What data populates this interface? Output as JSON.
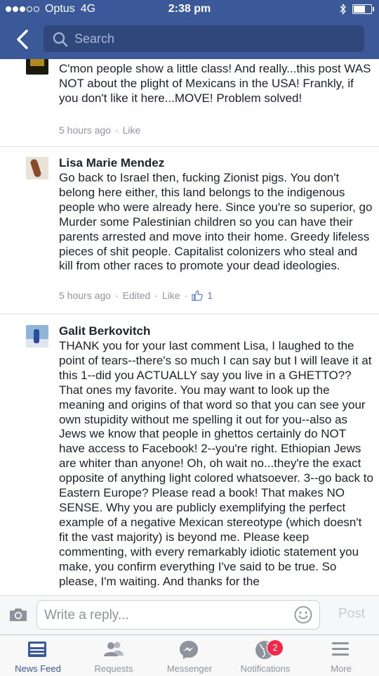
{
  "status_bar": {
    "carrier": "Optus",
    "network": "4G",
    "time": "2:38 pm"
  },
  "nav": {
    "search_placeholder": "Search"
  },
  "comments": [
    {
      "author": "",
      "text": "C'mon people show a little class! And really...this post WAS NOT about the plight of Mexicans in the USA! Frankly,  if you don't like it here...MOVE! Problem solved!",
      "time": "5 hours ago",
      "like_label": "Like"
    },
    {
      "author": "Lisa Marie Mendez",
      "text": "Go back to Israel then, fucking Zionist pigs. You don't belong here either, this land belongs to the indigenous people who were already here. Since you're so superior, go Murder some Palestinian children so you can have their parents arrested and move into their home. Greedy lifeless pieces of shit people. Capitalist colonizers who steal and kill from other races to promote your dead ideologies.",
      "time": "5 hours ago",
      "edited_label": "Edited",
      "like_label": "Like",
      "like_count": "1"
    },
    {
      "author": "Galit Berkovitch",
      "text": "THANK you for your last comment Lisa, I laughed to the point of tears--there's so much I can say but I will leave it at this 1--did you ACTUALLY say you live in a GHETTO?? That ones my favorite. You may want to look up the meaning and origins of that word so that you can see your own stupidity without me spelling it out for you--also as Jews we know that people in ghettos certainly do NOT have access to Facebook! 2--you're right. Ethiopian Jews are whiter than anyone! Oh, oh wait no...they're the exact opposite of anything light colored whatsoever. 3--go back to Eastern Europe? Please read a book! That makes NO SENSE. Why you are publicly exemplifying the perfect example of a negative Mexican stereotype (which doesn't fit the vast majority) is beyond me. Please keep commenting, with every remarkably idiotic statement you make, you confirm everything I've said to be true. So please, I'm waiting. And thanks for the"
    }
  ],
  "reply_bar": {
    "placeholder": "Write a reply...",
    "post_label": "Post"
  },
  "tabs": [
    {
      "label": "News Feed",
      "icon": "news-feed-icon",
      "active": true
    },
    {
      "label": "Requests",
      "icon": "requests-icon"
    },
    {
      "label": "Messenger",
      "icon": "messenger-icon"
    },
    {
      "label": "Notifications",
      "icon": "globe-icon",
      "badge": "2"
    },
    {
      "label": "More",
      "icon": "menu-icon"
    }
  ],
  "colors": {
    "brand_blue": "#3b5998",
    "badge_red": "#f02849"
  }
}
